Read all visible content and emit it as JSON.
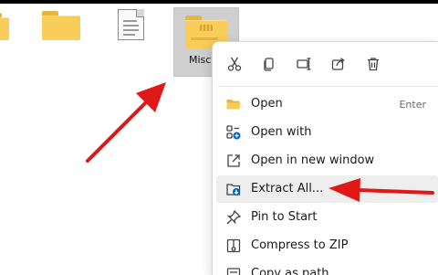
{
  "files": {
    "selected_label": "Misc."
  },
  "menu": {
    "quick_actions": [
      {
        "icon": "cut-icon"
      },
      {
        "icon": "copy-icon"
      },
      {
        "icon": "rename-icon"
      },
      {
        "icon": "share-icon"
      },
      {
        "icon": "delete-icon"
      }
    ],
    "items": [
      {
        "label": "Open",
        "shortcut": "Enter",
        "icon": "folder-open-icon"
      },
      {
        "label": "Open with",
        "icon": "open-with-icon"
      },
      {
        "label": "Open in new window",
        "icon": "new-window-icon"
      },
      {
        "label": "Extract All...",
        "icon": "extract-icon"
      },
      {
        "label": "Pin to Start",
        "icon": "pin-icon"
      },
      {
        "label": "Compress to ZIP",
        "icon": "zip-icon"
      },
      {
        "label": "Copy as path",
        "icon": "copy-path-icon"
      }
    ]
  },
  "colors": {
    "folder": "#f8cd5a",
    "selection": "#cfcfcf",
    "accent": "#0067c0",
    "annotation_arrow": "#e01818"
  }
}
